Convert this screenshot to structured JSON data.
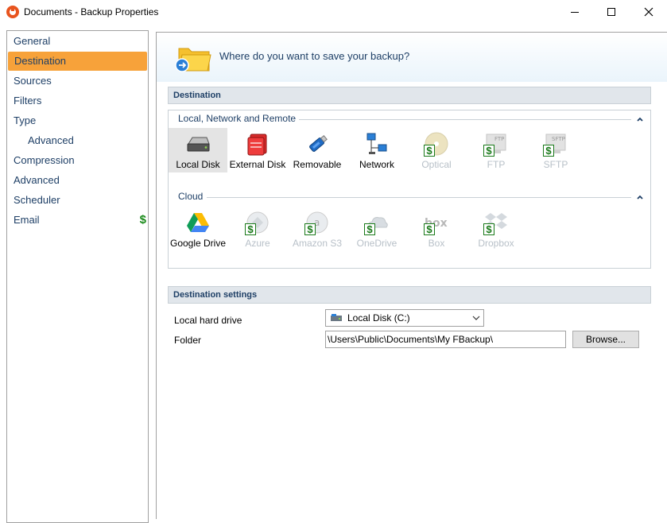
{
  "window": {
    "title": "Documents - Backup Properties"
  },
  "sidebar": {
    "items": [
      {
        "label": "General",
        "active": false,
        "sub": false
      },
      {
        "label": "Destination",
        "active": true,
        "sub": false
      },
      {
        "label": "Sources",
        "active": false,
        "sub": false
      },
      {
        "label": "Filters",
        "active": false,
        "sub": false
      },
      {
        "label": "Type",
        "active": false,
        "sub": false
      },
      {
        "label": "Advanced",
        "active": false,
        "sub": true
      },
      {
        "label": "Compression",
        "active": false,
        "sub": false
      },
      {
        "label": "Advanced",
        "active": false,
        "sub": false
      },
      {
        "label": "Scheduler",
        "active": false,
        "sub": false
      },
      {
        "label": "Email",
        "active": false,
        "sub": false,
        "badge": "$"
      }
    ]
  },
  "header": {
    "text": "Where do you want to save your backup?"
  },
  "destination": {
    "section_title": "Destination",
    "local_group": {
      "title": "Local, Network and Remote",
      "items": [
        {
          "label": "Local Disk",
          "icon": "hard-disk-icon",
          "enabled": true,
          "selected": true
        },
        {
          "label": "External Disk",
          "icon": "external-disk-icon",
          "enabled": true
        },
        {
          "label": "Removable",
          "icon": "usb-stick-icon",
          "enabled": true
        },
        {
          "label": "Network",
          "icon": "network-icon",
          "enabled": true
        },
        {
          "label": "Optical",
          "icon": "optical-disc-icon",
          "enabled": false,
          "paid": true
        },
        {
          "label": "FTP",
          "icon": "ftp-icon",
          "enabled": false,
          "paid": true
        },
        {
          "label": "SFTP",
          "icon": "sftp-icon",
          "enabled": false,
          "paid": true
        }
      ]
    },
    "cloud_group": {
      "title": "Cloud",
      "items": [
        {
          "label": "Google Drive",
          "icon": "google-drive-icon",
          "enabled": true
        },
        {
          "label": "Azure",
          "icon": "azure-icon",
          "enabled": false,
          "paid": true
        },
        {
          "label": "Amazon S3",
          "icon": "amazon-s3-icon",
          "enabled": false,
          "paid": true
        },
        {
          "label": "OneDrive",
          "icon": "onedrive-icon",
          "enabled": false,
          "paid": true
        },
        {
          "label": "Box",
          "icon": "box-icon",
          "enabled": false,
          "paid": true
        },
        {
          "label": "Dropbox",
          "icon": "dropbox-icon",
          "enabled": false,
          "paid": true
        }
      ]
    }
  },
  "settings": {
    "section_title": "Destination settings",
    "drive_label": "Local hard drive",
    "drive_value": "Local Disk (C:)",
    "folder_label": "Folder",
    "folder_value": "\\Users\\Public\\Documents\\My FBackup\\",
    "browse_label": "Browse..."
  },
  "colors": {
    "accent": "#f7a23a",
    "label_blue": "#1e3f66",
    "paid_green": "#1a7a1a"
  }
}
